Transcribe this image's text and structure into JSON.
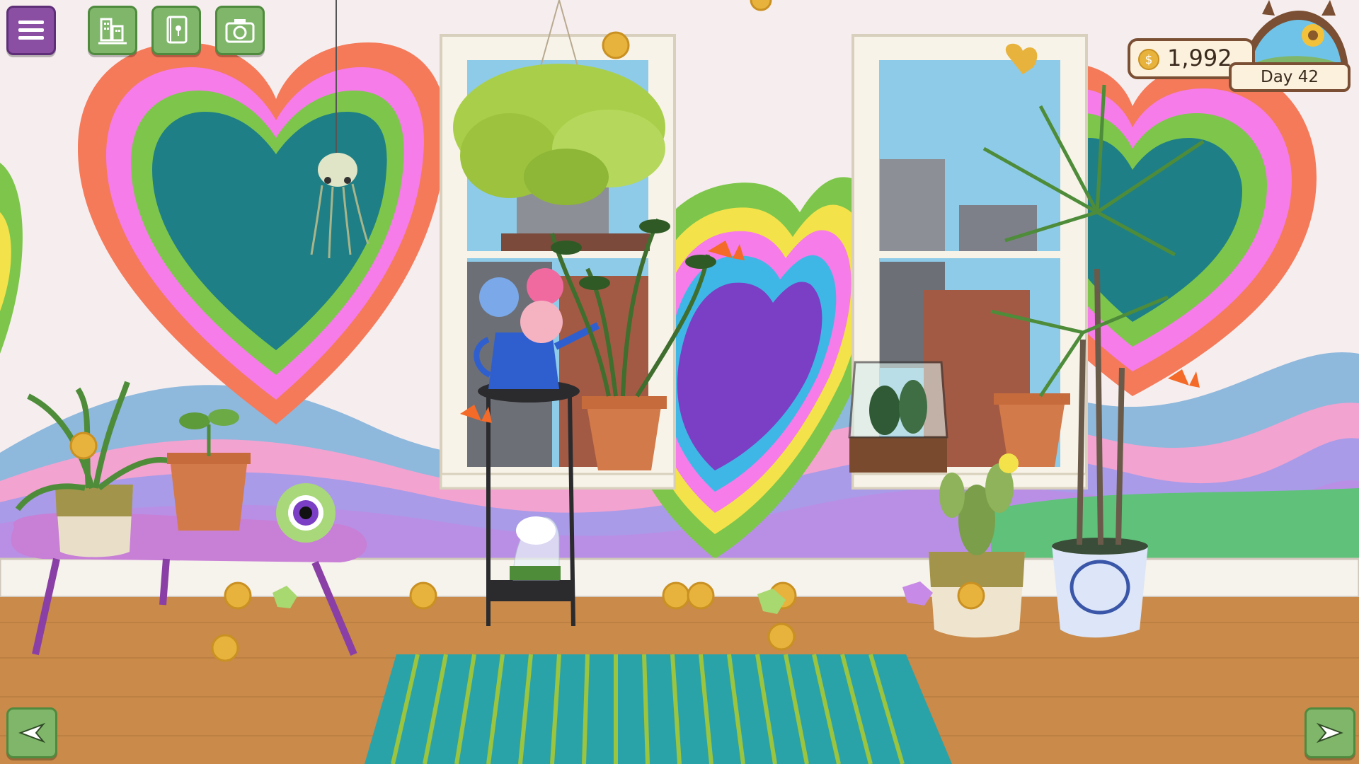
{
  "hud": {
    "coins": "1,992",
    "day": "Day 42"
  },
  "toolbar": {
    "menu_icon": "hamburger-icon",
    "buttons": [
      {
        "name": "city-button",
        "icon": "buildings-icon"
      },
      {
        "name": "plant-journal-button",
        "icon": "journal-icon"
      },
      {
        "name": "camera-button",
        "icon": "camera-icon"
      }
    ]
  },
  "navigation": {
    "prev_icon": "arrow-left-icon",
    "next_icon": "arrow-right-icon"
  },
  "colors": {
    "menu": "#8a4fa3",
    "ui_green": "#7fb66a",
    "wall": "#f6eeee",
    "floor": "#c98a4a",
    "rug": "#2aa3a8"
  }
}
